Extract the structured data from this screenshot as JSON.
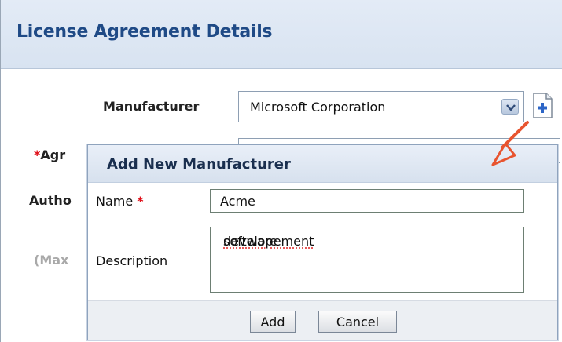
{
  "header": {
    "title": "License Agreement Details"
  },
  "form": {
    "manufacturer_label": "Manufacturer",
    "manufacturer_value": "Microsoft Corporation",
    "agreement_label_partial": "Agr",
    "authorized_label_partial": "Autho",
    "max_label_partial": "(Max",
    "required_marker": "*"
  },
  "dialog": {
    "title": "Add New Manufacturer",
    "name_label": "Name",
    "name_required": "*",
    "name_value": "Acme",
    "description_label": "Description",
    "description_value_1": "software",
    "description_value_2": "developement",
    "add_button": "Add",
    "cancel_button": "Cancel"
  },
  "icons": {
    "dropdown": "chevron-down-icon",
    "new_manufacturer": "add-document-icon",
    "callout": "red-arrow-icon"
  },
  "colors": {
    "title_blue": "#1f4a86",
    "required_red": "#e0101a",
    "arrow_red": "#e8542f"
  }
}
